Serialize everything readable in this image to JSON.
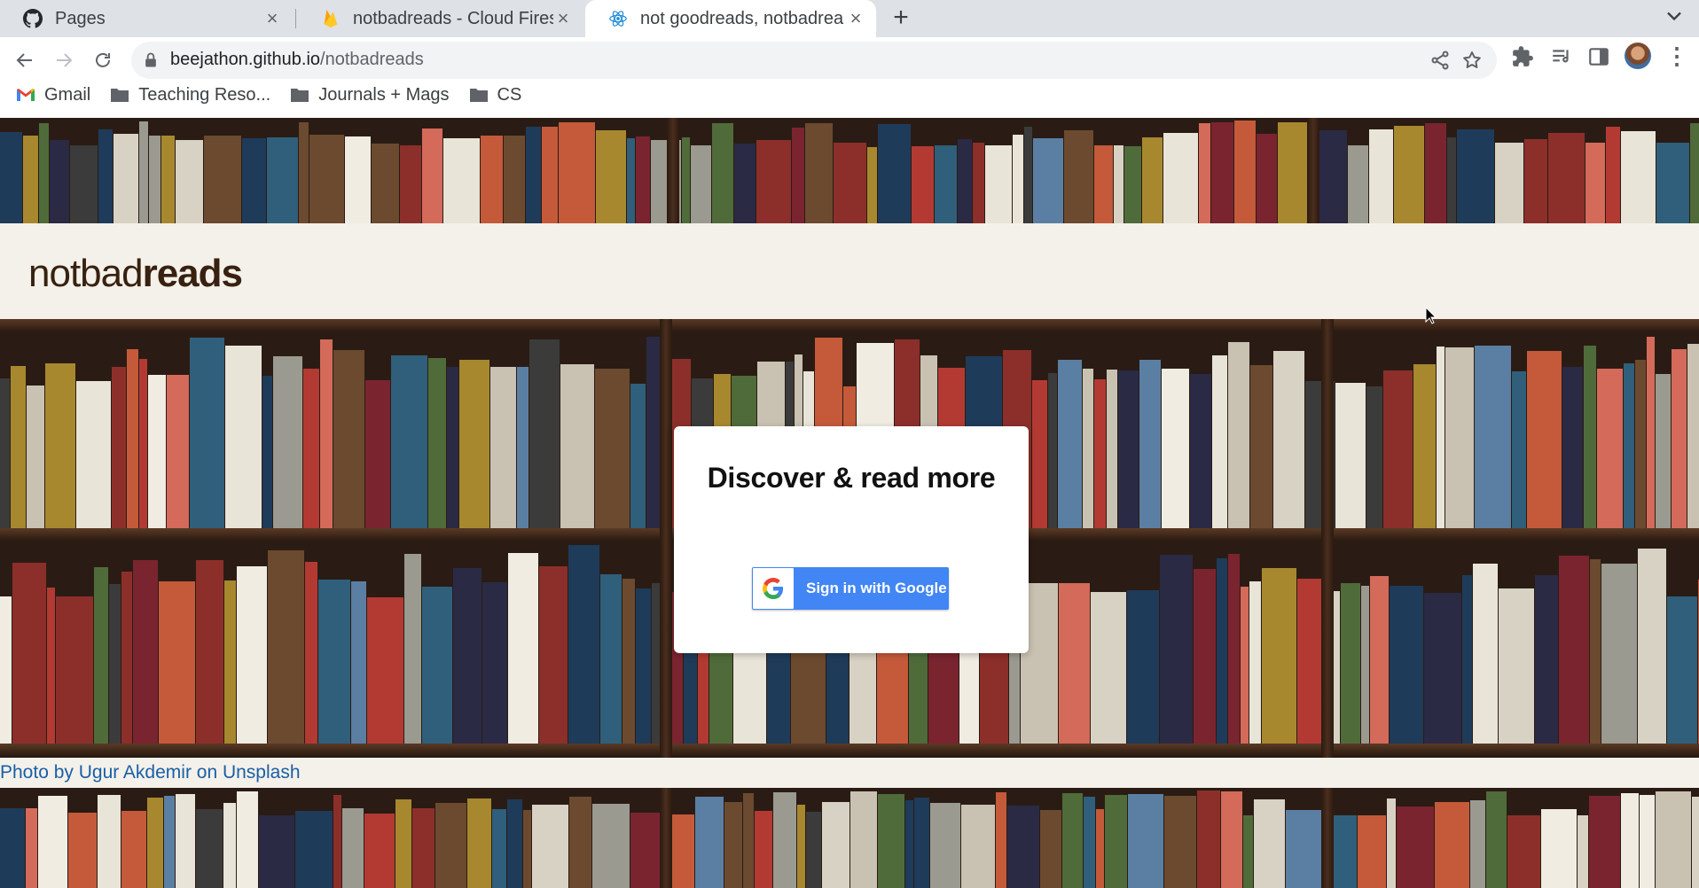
{
  "browser": {
    "tabs": [
      {
        "title": "Pages",
        "favicon": "github-icon",
        "active": false
      },
      {
        "title": "notbadreads - Cloud Fires",
        "favicon": "firebase-icon",
        "active": false
      },
      {
        "title": "not goodreads, notbadrea",
        "favicon": "react-icon",
        "active": true
      }
    ],
    "new_tab_symbol": "+",
    "close_symbol": "×",
    "url_host": "beejathon.github.io",
    "url_path": "/notbadreads",
    "bookmarks": [
      {
        "label": "Gmail",
        "icon": "gmail-icon"
      },
      {
        "label": "Teaching Reso...",
        "icon": "folder-icon"
      },
      {
        "label": "Journals + Mags",
        "icon": "folder-icon"
      },
      {
        "label": "CS",
        "icon": "folder-icon"
      }
    ]
  },
  "page": {
    "logo_light": "notbad",
    "logo_bold": "reads",
    "card": {
      "heading": "Discover & read more",
      "signin_label": "Sign in with Google"
    },
    "photo_credit": "Photo by Ugur Akdemir on Unsplash"
  },
  "colors": {
    "brand_brown": "#382110",
    "band_bg": "#f4f1ea",
    "google_blue": "#4285f4",
    "credit_link": "#1a5fa6"
  }
}
